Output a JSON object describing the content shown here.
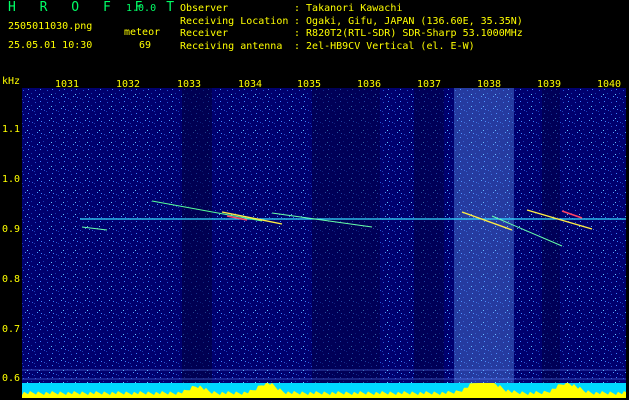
{
  "app": {
    "title": "H R O F F T",
    "version": "1.0.0"
  },
  "file": {
    "name": "2505011030.png",
    "datetime": "25.05.01 10:30"
  },
  "meteor": {
    "label": "meteor",
    "count": "69"
  },
  "info": [
    {
      "label": "Observer",
      "value": ": Takanori Kawachi"
    },
    {
      "label": "Receiving Location",
      "value": ": Ogaki, Gifu, JAPAN (136.60E, 35.35N)"
    },
    {
      "label": "Receiver",
      "value": ": R820T2(RTL-SDR) SDR-Sharp 53.1000MHz"
    },
    {
      "label": "Receiving antenna",
      "value": ": 2el-HB9CV Vertical (el. E-W)"
    }
  ],
  "axis": {
    "unit": "kHz",
    "x_ticks": [
      "1031",
      "1032",
      "1033",
      "1034",
      "1035",
      "1036",
      "1037",
      "1038",
      "1039",
      "1040"
    ],
    "y_ticks": [
      "1.1",
      "1.0",
      "0.9",
      "0.8",
      "0.7",
      "0.6"
    ]
  },
  "colors": {
    "label": "#ffff00",
    "title": "#00ff66",
    "spectrum": "#ffff00",
    "background": "#000080"
  }
}
